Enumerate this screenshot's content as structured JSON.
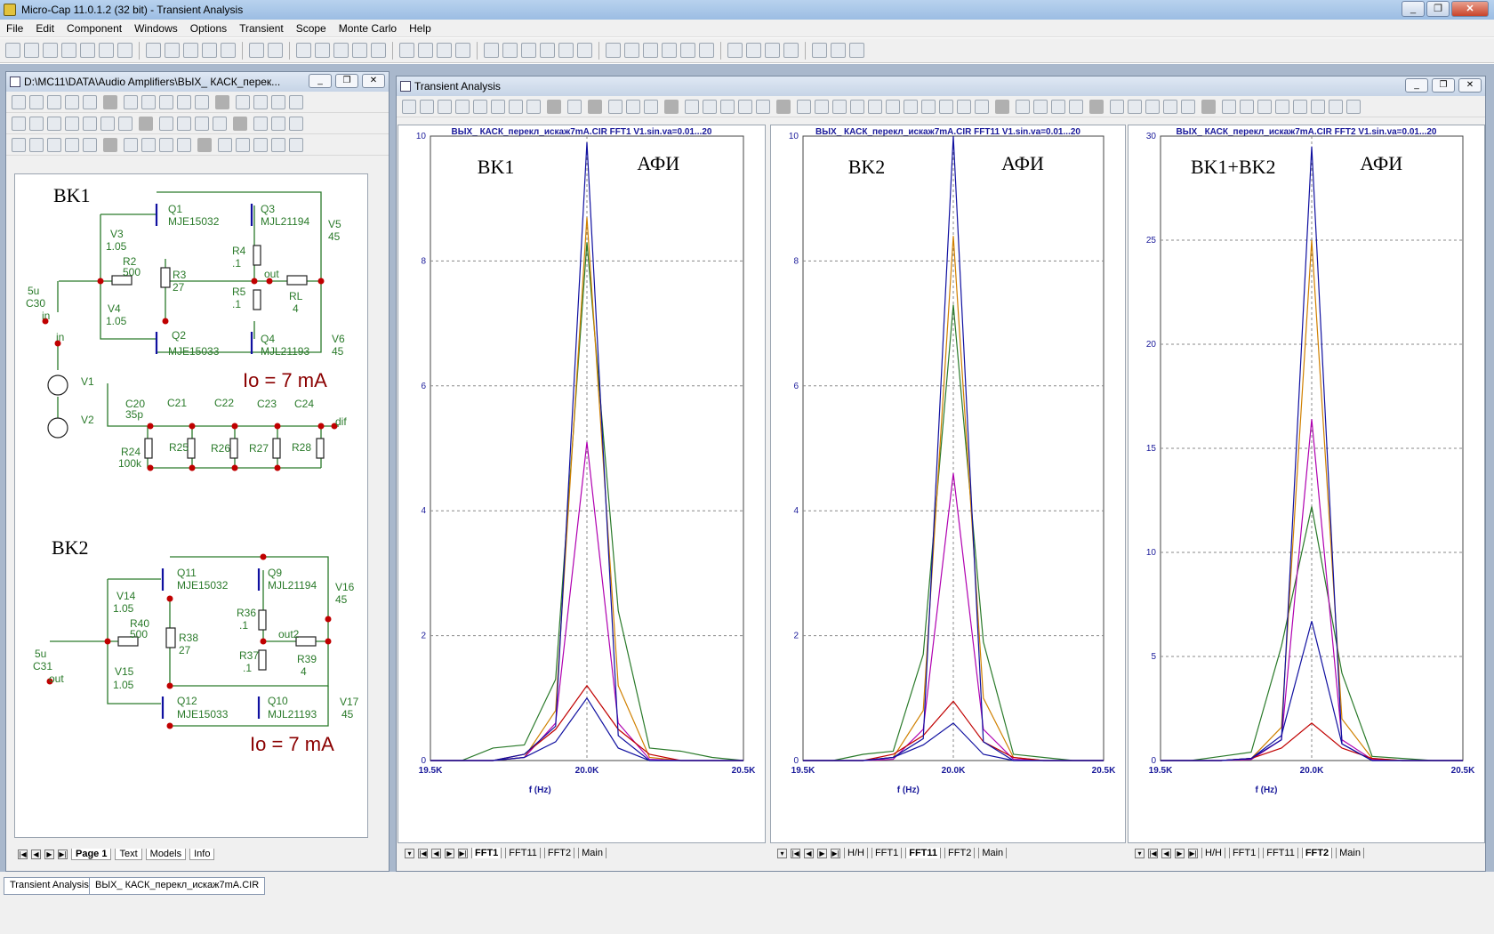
{
  "app": {
    "title": "Micro-Cap 11.0.1.2 (32 bit) - Transient Analysis"
  },
  "window_buttons": {
    "min": "_",
    "max": "❐",
    "close": "✕"
  },
  "menu": [
    "File",
    "Edit",
    "Component",
    "Windows",
    "Options",
    "Transient",
    "Scope",
    "Monte Carlo",
    "Help"
  ],
  "schematic_window": {
    "title": "D:\\MC11\\DATA\\Audio Amplifiers\\ВЫХ_ КАСК_перек...",
    "page_tabs": [
      "Page 1",
      "Text",
      "Models",
      "Info"
    ],
    "active_tab": "Page 1",
    "labels": {
      "bk1": "BK1",
      "bk2": "BK2",
      "io1": "Io = 7 mA",
      "io2": "Io = 7 mA",
      "q1": "Q1",
      "q1m": "MJE15032",
      "q3": "Q3",
      "q3m": "MJL21194",
      "q2": "Q2",
      "q2m": "MJE15033",
      "q4": "Q4",
      "q4m": "MJL21193",
      "v3": "V3",
      "v3v": "1.05",
      "v4": "V4",
      "v4v": "1.05",
      "v5": "V5",
      "v5v": "45",
      "v6": "V6",
      "v6v": "45",
      "r2": "R2",
      "r2v": "500",
      "r3": "R3",
      "r3v": "27",
      "r4": "R4",
      "r4v": ".1",
      "r5": "R5",
      "r5v": ".1",
      "rl": "RL",
      "rlv": "4",
      "out": "out",
      "c30": "C30",
      "c30v": "5u",
      "in1": "in",
      "in2": "in",
      "v1": "V1",
      "v2": "V2",
      "c20": "C20",
      "c20v": "35p",
      "c21": "C21",
      "c22": "C22",
      "c23": "C23",
      "c24": "C24",
      "r24": "R24",
      "r24v": "100k",
      "r25": "R25",
      "r26": "R26",
      "r27": "R27",
      "r28": "R28",
      "dif": "dif",
      "q11": "Q11",
      "q11m": "MJE15032",
      "q9": "Q9",
      "q9m": "MJL21194",
      "q12": "Q12",
      "q12m": "MJE15033",
      "q10": "Q10",
      "q10m": "MJL21193",
      "v14": "V14",
      "v14v": "1.05",
      "v15": "V15",
      "v15v": "1.05",
      "v16": "V16",
      "v16v": "45",
      "v17": "V17",
      "v17v": "45",
      "r40": "R40",
      "r40v": "500",
      "r38": "R38",
      "r38v": "27",
      "r36": "R36",
      "r36v": ".1",
      "r37": "R37",
      "r37v": ".1",
      "r39": "R39",
      "r39v": "4",
      "out2": "out2",
      "c31": "C31",
      "c31v": "5u",
      "outl": "out"
    }
  },
  "analysis_window": {
    "title": "Transient Analysis"
  },
  "colors": {
    "green": "#2a7a2a",
    "navy": "#1010a0",
    "red": "#c00000",
    "purple": "#b000b0",
    "orange": "#d08000",
    "grid": "#888888"
  },
  "chart_data": [
    {
      "type": "line",
      "title": "ВЫХ_ КАСК_перекл_искаж7mA.CIR FFT1 V1.sin.va=0.01...20",
      "xlabel": "f (Hz)",
      "x_tick_labels": [
        "19.5K",
        "20.0K",
        "20.5K"
      ],
      "y_tick_labels": [
        "0",
        "2",
        "4",
        "6",
        "8",
        "10"
      ],
      "ylim": [
        0,
        10
      ],
      "annotations": [
        "BK1",
        "АФИ"
      ],
      "x": [
        19500,
        19600,
        19700,
        19800,
        19900,
        20000,
        20100,
        20200,
        20300,
        20400,
        20500
      ],
      "series": [
        {
          "color": "green",
          "values": [
            0,
            0,
            0.2,
            0.25,
            1.3,
            8.3,
            2.4,
            0.2,
            0.15,
            0.05,
            0
          ]
        },
        {
          "color": "orange",
          "values": [
            0,
            0,
            0,
            0.05,
            0.8,
            8.7,
            1.2,
            0.05,
            0,
            0,
            0
          ]
        },
        {
          "color": "purple",
          "values": [
            0,
            0,
            0,
            0.05,
            0.6,
            5.1,
            0.6,
            0.02,
            0,
            0,
            0
          ]
        },
        {
          "color": "red",
          "values": [
            0,
            0,
            0,
            0.1,
            0.5,
            1.2,
            0.5,
            0.1,
            0,
            0,
            0
          ]
        },
        {
          "color": "navy",
          "values": [
            0,
            0,
            0,
            0.1,
            0.55,
            9.9,
            0.4,
            0,
            0,
            0,
            0
          ]
        },
        {
          "color": "navy",
          "values": [
            0,
            0,
            0,
            0.05,
            0.3,
            1.0,
            0.2,
            0,
            0,
            0,
            0
          ]
        }
      ],
      "tabs": [
        "FFT1",
        "FFT11",
        "FFT2",
        "Main"
      ],
      "active_tab": "FFT1"
    },
    {
      "type": "line",
      "title": "ВЫХ_ КАСК_перекл_искаж7mA.CIR FFT11 V1.sin.va=0.01...20",
      "xlabel": "f (Hz)",
      "x_tick_labels": [
        "19.5K",
        "20.0K",
        "20.5K"
      ],
      "y_tick_labels": [
        "0",
        "2",
        "4",
        "6",
        "8",
        "10"
      ],
      "ylim": [
        0,
        10
      ],
      "annotations": [
        "BK2",
        "АФИ"
      ],
      "x": [
        19500,
        19600,
        19700,
        19800,
        19900,
        20000,
        20100,
        20200,
        20300,
        20400,
        20500
      ],
      "series": [
        {
          "color": "green",
          "values": [
            0,
            0,
            0.1,
            0.15,
            1.7,
            7.3,
            1.9,
            0.1,
            0.05,
            0,
            0
          ]
        },
        {
          "color": "orange",
          "values": [
            0,
            0,
            0,
            0.05,
            0.8,
            8.4,
            1.0,
            0.05,
            0,
            0,
            0
          ]
        },
        {
          "color": "purple",
          "values": [
            0,
            0,
            0,
            0.02,
            0.5,
            4.6,
            0.5,
            0.02,
            0,
            0,
            0
          ]
        },
        {
          "color": "red",
          "values": [
            0,
            0,
            0,
            0.1,
            0.4,
            0.95,
            0.3,
            0.05,
            0,
            0,
            0
          ]
        },
        {
          "color": "navy",
          "values": [
            0,
            0,
            0,
            0.05,
            0.35,
            10.0,
            0.3,
            0,
            0,
            0,
            0
          ]
        },
        {
          "color": "navy",
          "values": [
            0,
            0,
            0,
            0.05,
            0.25,
            0.6,
            0.1,
            0,
            0,
            0,
            0
          ]
        }
      ],
      "tabs": [
        "H/H",
        "FFT1",
        "FFT11",
        "FFT2",
        "Main"
      ],
      "active_tab": "FFT11"
    },
    {
      "type": "line",
      "title": "ВЫХ_ КАСК_перекл_искаж7mA.CIR FFT2 V1.sin.va=0.01...20",
      "xlabel": "f (Hz)",
      "x_tick_labels": [
        "19.5K",
        "20.0K",
        "20.5K"
      ],
      "y_tick_labels": [
        "0",
        "5",
        "10",
        "15",
        "20",
        "25",
        "30"
      ],
      "ylim": [
        0,
        30
      ],
      "annotations": [
        "BK1+BK2",
        "АФИ"
      ],
      "x": [
        19500,
        19600,
        19700,
        19800,
        19900,
        20000,
        20100,
        20200,
        20300,
        20400,
        20500
      ],
      "series": [
        {
          "color": "green",
          "values": [
            0,
            0,
            0.2,
            0.4,
            5.5,
            12.2,
            4.2,
            0.2,
            0.1,
            0,
            0
          ]
        },
        {
          "color": "orange",
          "values": [
            0,
            0,
            0,
            0.1,
            1.6,
            25.0,
            2.0,
            0.1,
            0,
            0,
            0
          ]
        },
        {
          "color": "purple",
          "values": [
            0,
            0,
            0,
            0.05,
            1.0,
            16.4,
            1.0,
            0.05,
            0,
            0,
            0
          ]
        },
        {
          "color": "red",
          "values": [
            0,
            0,
            0,
            0.1,
            0.6,
            1.8,
            0.6,
            0.1,
            0,
            0,
            0
          ]
        },
        {
          "color": "navy",
          "values": [
            0,
            0,
            0,
            0.1,
            1.0,
            29.5,
            0.8,
            0,
            0,
            0,
            0
          ]
        },
        {
          "color": "navy",
          "values": [
            0,
            0,
            0,
            0.1,
            1.2,
            6.7,
            0.8,
            0,
            0,
            0,
            0
          ]
        }
      ],
      "tabs": [
        "H/H",
        "FFT1",
        "FFT11",
        "FFT2",
        "Main"
      ],
      "active_tab": "FFT2"
    }
  ],
  "taskbar": {
    "tab1": "Transient Analysis",
    "tab2": "ВЫХ_ КАСК_перекл_искаж7mA.CIR"
  }
}
